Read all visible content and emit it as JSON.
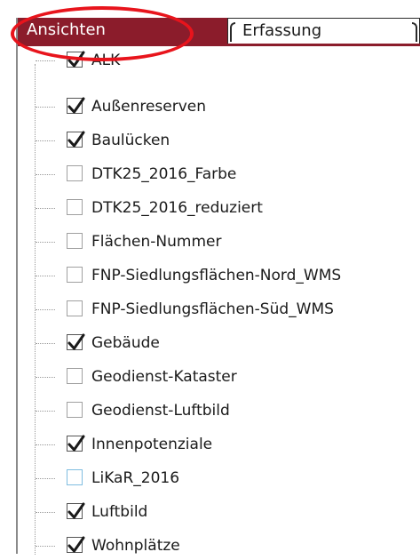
{
  "tabs": [
    {
      "label": "Ansichten",
      "active": true
    },
    {
      "label": "Erfassung",
      "active": false
    }
  ],
  "layers": [
    {
      "label": "ALK",
      "checked": true
    },
    {
      "label": "Außenreserven",
      "checked": true
    },
    {
      "label": "Baulücken",
      "checked": true
    },
    {
      "label": "DTK25_2016_Farbe",
      "checked": false
    },
    {
      "label": "DTK25_2016_reduziert",
      "checked": false
    },
    {
      "label": "Flächen-Nummer",
      "checked": false
    },
    {
      "label": "FNP-Siedlungsflächen-Nord_WMS",
      "checked": false
    },
    {
      "label": "FNP-Siedlungsflächen-Süd_WMS",
      "checked": false
    },
    {
      "label": "Gebäude",
      "checked": true
    },
    {
      "label": "Geodienst-Kataster",
      "checked": false
    },
    {
      "label": "Geodienst-Luftbild",
      "checked": false
    },
    {
      "label": "Innenpotenziale",
      "checked": true
    },
    {
      "label": "LiKaR_2016",
      "checked": false,
      "highlight": true
    },
    {
      "label": "Luftbild",
      "checked": true
    },
    {
      "label": "Wohnplätze",
      "checked": true
    }
  ],
  "colors": {
    "active_tab": "#8b1c2b",
    "annotation": "#e8141c",
    "checkmark": "#1a1a1a",
    "highlight_border": "#7fbde0"
  }
}
